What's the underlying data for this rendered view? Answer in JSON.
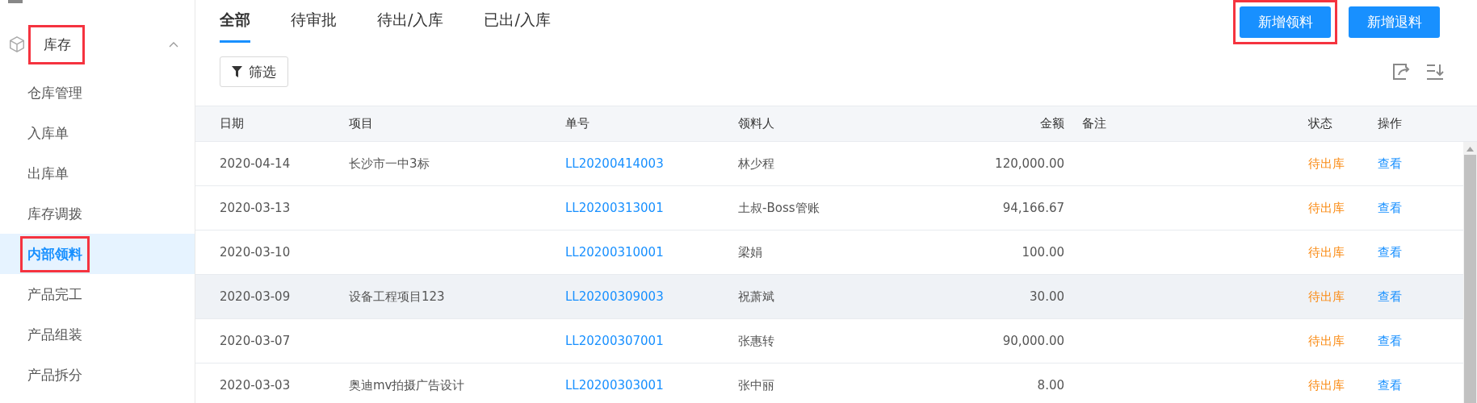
{
  "sidebar": {
    "group": {
      "label": "库存",
      "expanded": true,
      "highlighted": true
    },
    "items": [
      {
        "label": "仓库管理",
        "selected": false,
        "highlighted": false
      },
      {
        "label": "入库单",
        "selected": false,
        "highlighted": false
      },
      {
        "label": "出库单",
        "selected": false,
        "highlighted": false
      },
      {
        "label": "库存调拨",
        "selected": false,
        "highlighted": false
      },
      {
        "label": "内部领料",
        "selected": true,
        "highlighted": true
      },
      {
        "label": "产品完工",
        "selected": false,
        "highlighted": false
      },
      {
        "label": "产品组装",
        "selected": false,
        "highlighted": false
      },
      {
        "label": "产品拆分",
        "selected": false,
        "highlighted": false
      }
    ]
  },
  "tabs": [
    {
      "label": "全部",
      "selected": true
    },
    {
      "label": "待审批",
      "selected": false
    },
    {
      "label": "待出/入库",
      "selected": false
    },
    {
      "label": "已出/入库",
      "selected": false
    }
  ],
  "actions": [
    {
      "label": "新增领料",
      "highlighted": true
    },
    {
      "label": "新增退料",
      "highlighted": false
    }
  ],
  "filter_button": "筛选",
  "table": {
    "columns": [
      "日期",
      "项目",
      "单号",
      "领料人",
      "金额",
      "备注",
      "状态",
      "操作"
    ],
    "rows": [
      {
        "date": "2020-04-14",
        "project": "长沙市一中3标",
        "number": "LL20200414003",
        "person": "林少程",
        "amount": "120,000.00",
        "status": "待出库",
        "action": "查看",
        "hovered": false
      },
      {
        "date": "2020-03-13",
        "number": "LL20200313001",
        "person": "土叔-Boss管账",
        "amount": "94,166.67",
        "status": "待出库",
        "action": "查看",
        "hovered": false
      },
      {
        "date": "2020-03-10",
        "number": "LL20200310001",
        "person": "梁娟",
        "amount": "100.00",
        "status": "待出库",
        "action": "查看",
        "hovered": false
      },
      {
        "date": "2020-03-09",
        "project": "设备工程项目123",
        "number": "LL20200309003",
        "person": "祝萧斌",
        "amount": "30.00",
        "status": "待出库",
        "action": "查看",
        "hovered": true
      },
      {
        "date": "2020-03-07",
        "number": "LL20200307001",
        "person": "张惠转",
        "amount": "90,000.00",
        "status": "待出库",
        "action": "查看",
        "hovered": false
      },
      {
        "date": "2020-03-03",
        "project": "奥迪mv拍摄广告设计",
        "number": "LL20200303001",
        "person": "张中丽",
        "amount": "8.00",
        "status": "待出库",
        "action": "查看",
        "hovered": false
      }
    ]
  }
}
